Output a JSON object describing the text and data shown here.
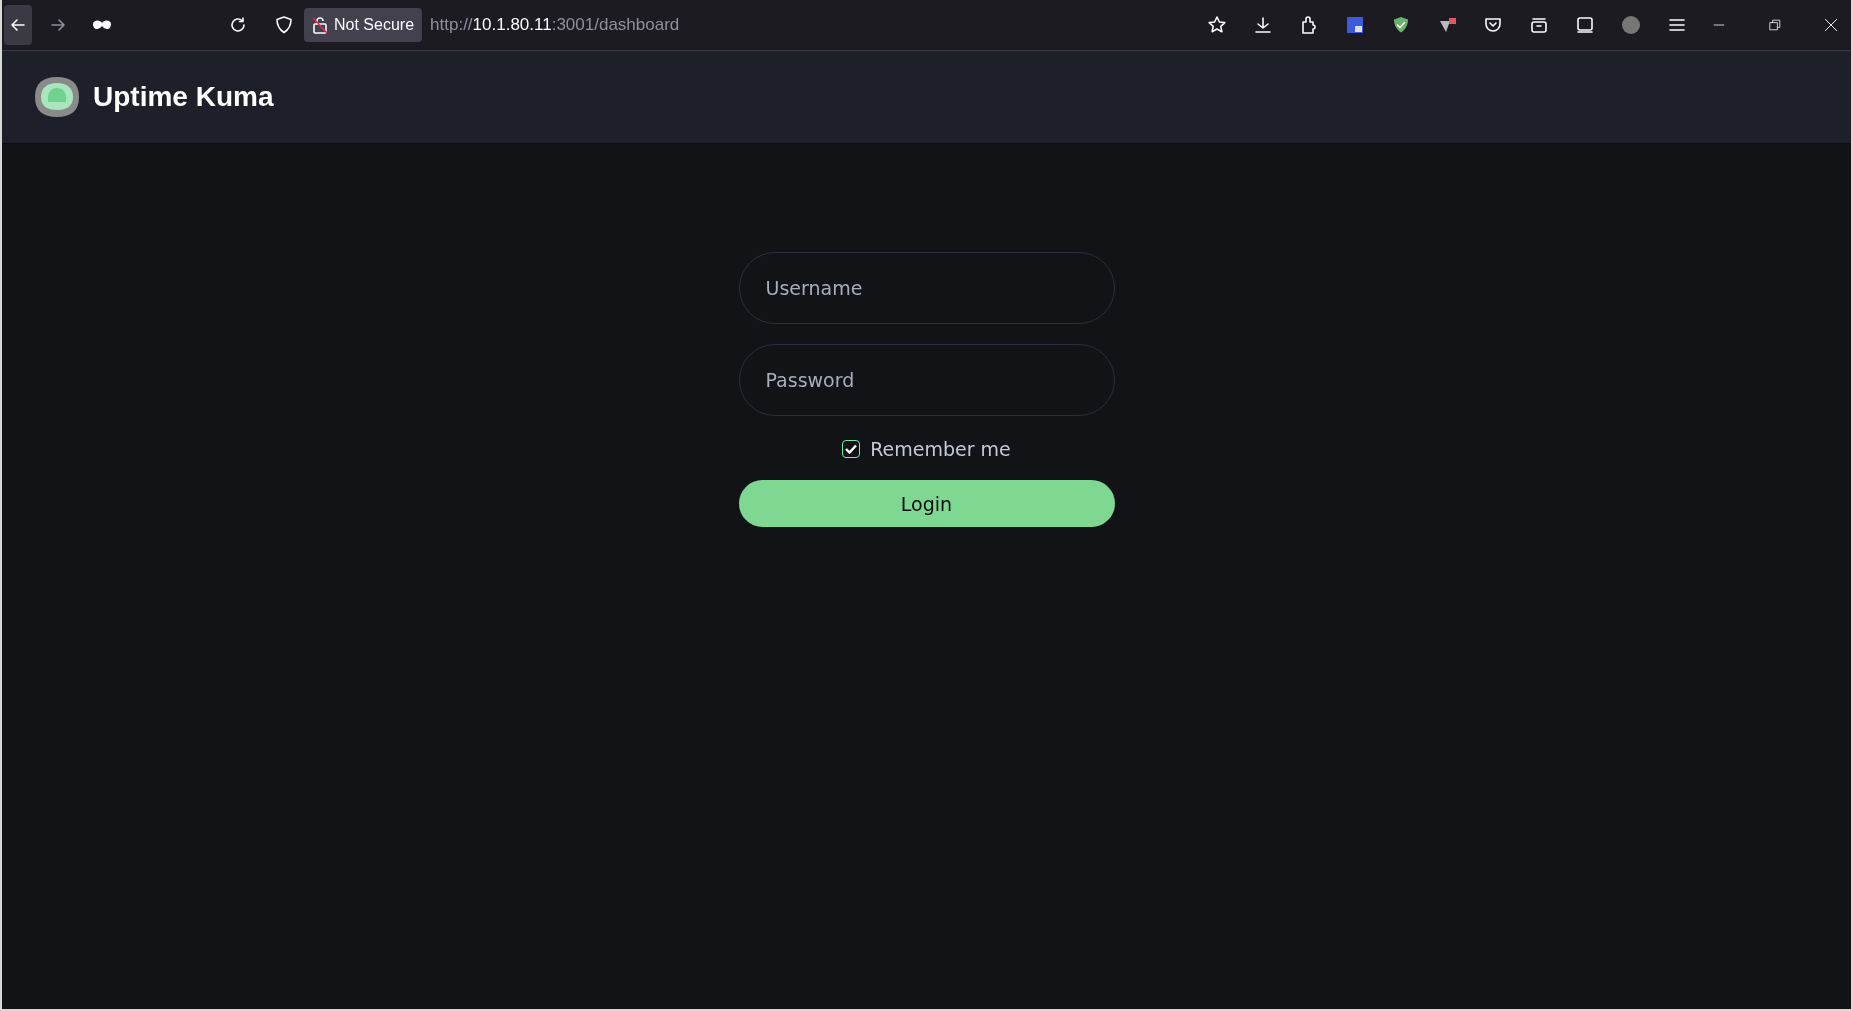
{
  "browser": {
    "security_label": "Not Secure",
    "url": {
      "scheme": "http://",
      "host": "10.1.80.11",
      "rest": ":3001/dashboard"
    }
  },
  "header": {
    "title": "Uptime Kuma"
  },
  "login": {
    "username": {
      "placeholder": "Username"
    },
    "password": {
      "placeholder": "Password"
    },
    "remember": {
      "label": "Remember me",
      "checked": true
    },
    "button": "Login"
  }
}
